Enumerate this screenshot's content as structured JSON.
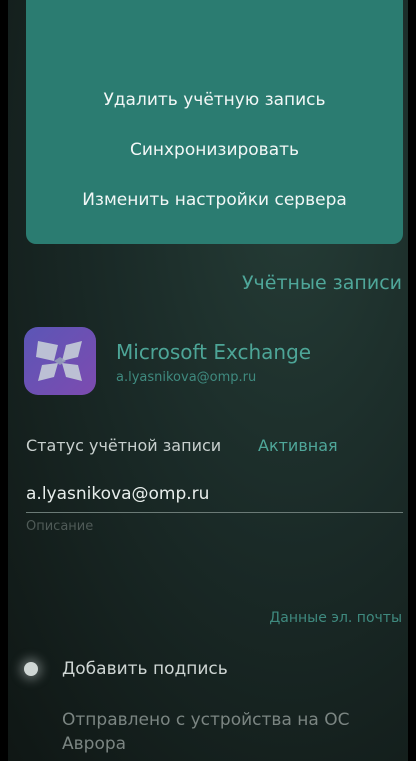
{
  "menu": {
    "items": [
      {
        "label": "Удалить учётную запись"
      },
      {
        "label": "Синхронизировать"
      },
      {
        "label": "Изменить настройки сервера"
      }
    ]
  },
  "header": {
    "title": "Учётные записи"
  },
  "account": {
    "icon": "microsoft-exchange-icon",
    "name": "Microsoft Exchange",
    "email": "a.lyasnikova@omp.ru"
  },
  "status": {
    "label": "Статус учётной записи",
    "value": "Активная"
  },
  "form": {
    "email_value": "a.lyasnikova@omp.ru",
    "description_placeholder": "Описание"
  },
  "mail_section": {
    "title": "Данные эл. почты"
  },
  "signature": {
    "toggle_label": "Добавить подпись",
    "enabled": true,
    "text": "Отправлено с устройства на ОС Аврора"
  },
  "colors": {
    "accent": "#4fa79a",
    "menu_bg": "#2b7c71",
    "icon_gradient_start": "#5b56b6",
    "icon_gradient_end": "#7d4bb0"
  }
}
